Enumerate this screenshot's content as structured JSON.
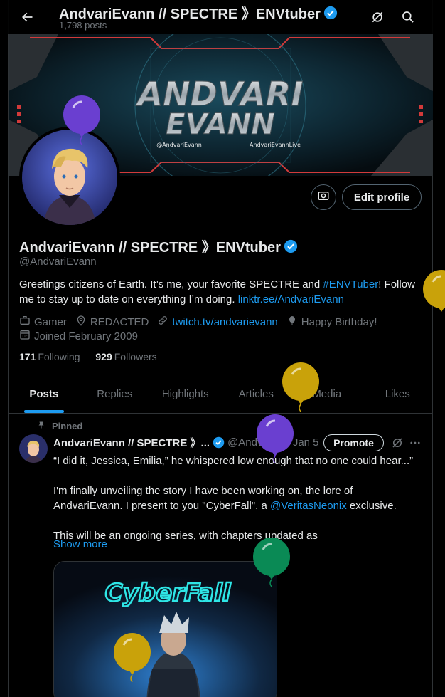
{
  "header": {
    "title": "AndvariEvann // SPECTRE 》ENVtuber",
    "post_count": "1,798 posts"
  },
  "banner": {
    "logo_line1": "ANDVARI",
    "logo_line2": "EVANN",
    "social_handle": "@AndvariEvann",
    "fb_handle": "AndvariEvannLive"
  },
  "profile": {
    "display_name": "AndvariEvann // SPECTRE 》ENVtuber",
    "handle": "@AndvariEvann",
    "edit_label": "Edit profile",
    "bio_text_1": "Greetings citizens of Earth. It’s me, your favorite SPECTRE and ",
    "bio_hashtag": "#ENVTuber",
    "bio_text_2": "! Follow me to stay up to date on everything I’m doing. ",
    "bio_link": "linktr.ee/AndvariEvann",
    "category": "Gamer",
    "location": "REDACTED",
    "website": "twitch.tv/andvarievann",
    "birthday": "Happy Birthday!",
    "joined": "Joined February 2009",
    "following_count": "171",
    "following_label": "Following",
    "followers_count": "929",
    "followers_label": "Followers"
  },
  "tabs": [
    "Posts",
    "Replies",
    "Highlights",
    "Articles",
    "Media",
    "Likes"
  ],
  "tweet": {
    "pinned_label": "Pinned",
    "author": "AndvariEvann // SPECTRE 》...",
    "handle": "@Andvari...",
    "date": "· Jan 5",
    "promote_label": "Promote",
    "para1": "“I did it, Jessica, Emilia,” he whispered low enough that no one could hear...”",
    "para2_a": "I'm finally unveiling the story I have been working on, the lore of AndvariEvann. I present to you \"CyberFall\", a ",
    "para2_mention": "@VeritasNeonix",
    "para2_b": " exclusive.",
    "para3": "This will be an ongoing series, with chapters updated as",
    "show_more": "Show more",
    "media_title": "CyberFall"
  },
  "colors": {
    "accent": "#1d9bf0",
    "balloon_purple": "#6a3fd0",
    "balloon_yellow": "#c9a20a",
    "balloon_green": "#0a8a55"
  }
}
